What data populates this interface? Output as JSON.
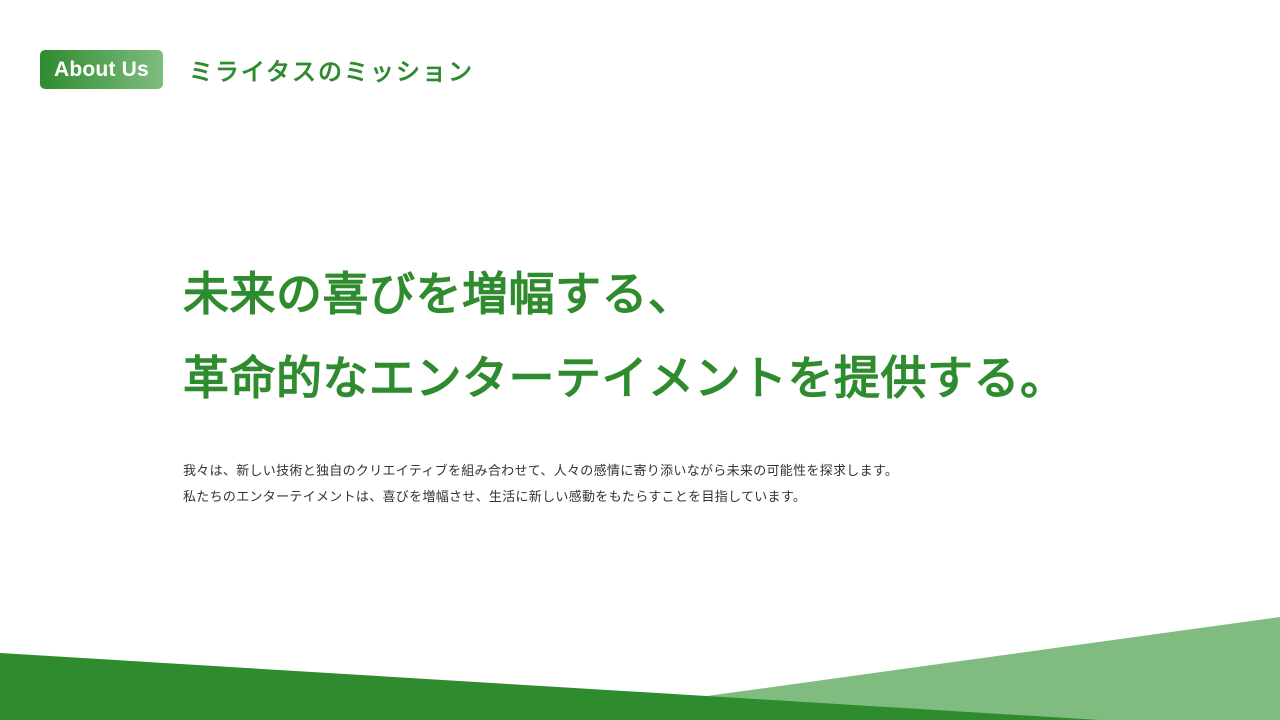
{
  "header": {
    "badge_label": "About Us",
    "section_title": "ミライタスのミッション"
  },
  "headline": {
    "line1": "未来の喜びを増幅する、",
    "line2": "革命的なエンターテイメントを提供する。"
  },
  "body": {
    "line1": "我々は、新しい技術と独自のクリエイティブを組み合わせて、人々の感情に寄り添いながら未来の可能性を探求します。",
    "line2": "私たちのエンターテイメントは、喜びを増幅させ、生活に新しい感動をもたらすことを目指しています。"
  },
  "colors": {
    "primary_green": "#2e8b2e",
    "light_green": "#80bc80",
    "text": "#333333",
    "background": "#ffffff"
  }
}
